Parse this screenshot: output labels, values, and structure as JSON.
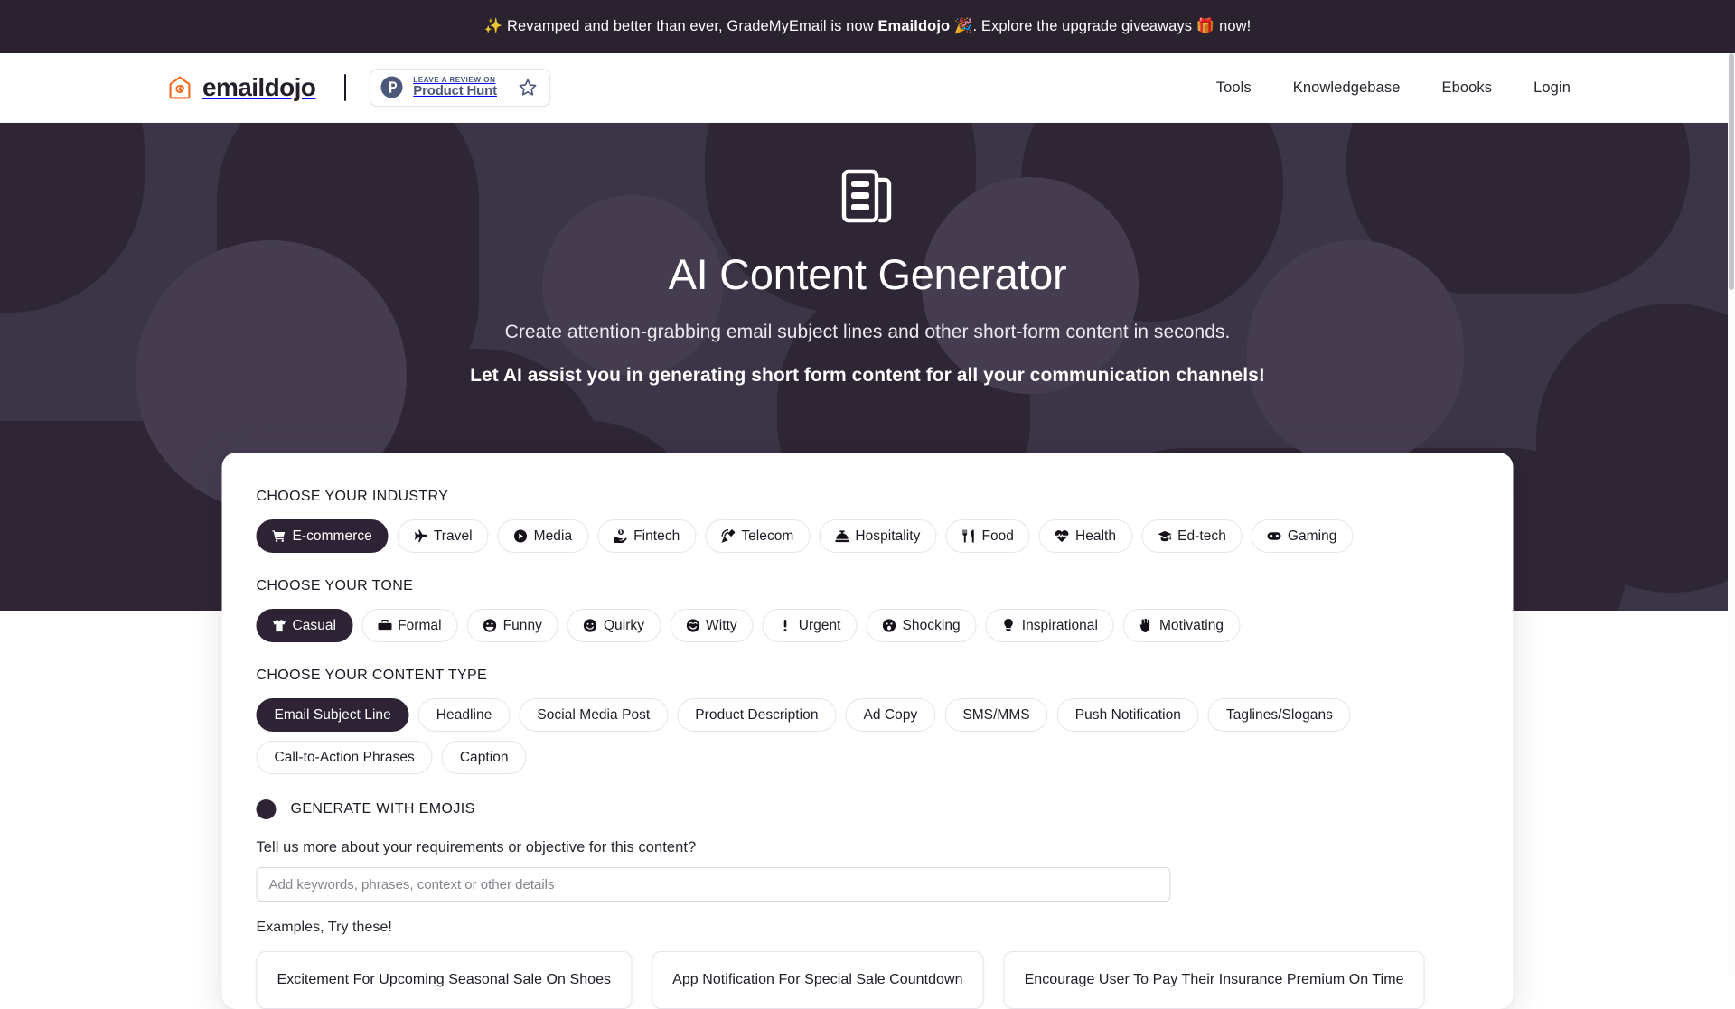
{
  "announcement": {
    "emoji_left": "✨",
    "text_before": "Revamped and better than ever, GradeMyEmail is now",
    "brand": "Emaildojo",
    "emoji_mid": "🎉",
    "text_mid": ". Explore the",
    "link": "upgrade giveaways",
    "emoji_right": "🎁",
    "text_after": "now!"
  },
  "header": {
    "logo_text": "emaildojo",
    "logo_icon": "emaildojo-spiral-house-icon",
    "product_hunt": {
      "small": "LEAVE A REVIEW ON",
      "big": "Product Hunt",
      "logo_icon": "product-hunt-p-icon",
      "star_icon": "star-outline-icon"
    },
    "nav": [
      {
        "label": "Tools"
      },
      {
        "label": "Knowledgebase"
      },
      {
        "label": "Ebooks"
      },
      {
        "label": "Login"
      }
    ]
  },
  "hero": {
    "icon": "newspaper-icon",
    "title": "AI Content Generator",
    "subtitle": "Create attention-grabbing email subject lines and other short-form content in seconds.",
    "tagline": "Let AI assist you in generating short form content for all your communication channels!"
  },
  "panel": {
    "industry": {
      "label": "CHOOSE YOUR INDUSTRY",
      "selected": "E-commerce",
      "options": [
        {
          "label": "E-commerce",
          "icon": "shopping-cart-icon"
        },
        {
          "label": "Travel",
          "icon": "plane-icon"
        },
        {
          "label": "Media",
          "icon": "play-circle-icon"
        },
        {
          "label": "Fintech",
          "icon": "hand-holding-dollar-icon"
        },
        {
          "label": "Telecom",
          "icon": "satellite-dish-icon"
        },
        {
          "label": "Hospitality",
          "icon": "concierge-bell-icon"
        },
        {
          "label": "Food",
          "icon": "utensils-icon"
        },
        {
          "label": "Health",
          "icon": "heartbeat-icon"
        },
        {
          "label": "Ed-tech",
          "icon": "graduation-cap-icon"
        },
        {
          "label": "Gaming",
          "icon": "gamepad-icon"
        }
      ]
    },
    "tone": {
      "label": "CHOOSE YOUR TONE",
      "selected": "Casual",
      "options": [
        {
          "label": "Casual",
          "icon": "tshirt-icon"
        },
        {
          "label": "Formal",
          "icon": "briefcase-icon"
        },
        {
          "label": "Funny",
          "icon": "grin-face-icon"
        },
        {
          "label": "Quirky",
          "icon": "smile-face-icon"
        },
        {
          "label": "Witty",
          "icon": "laugh-face-icon"
        },
        {
          "label": "Urgent",
          "icon": "exclamation-icon"
        },
        {
          "label": "Shocking",
          "icon": "surprise-face-icon"
        },
        {
          "label": "Inspirational",
          "icon": "lightbulb-icon"
        },
        {
          "label": "Motivating",
          "icon": "fist-raised-icon"
        }
      ]
    },
    "content_type": {
      "label": "CHOOSE YOUR CONTENT TYPE",
      "selected": "Email Subject Line",
      "options": [
        {
          "label": "Email Subject Line"
        },
        {
          "label": "Headline"
        },
        {
          "label": "Social Media Post"
        },
        {
          "label": "Product Description"
        },
        {
          "label": "Ad Copy"
        },
        {
          "label": "SMS/MMS"
        },
        {
          "label": "Push Notification"
        },
        {
          "label": "Taglines/Slogans"
        },
        {
          "label": "Call-to-Action Phrases"
        },
        {
          "label": "Caption"
        }
      ]
    },
    "emoji_toggle": {
      "label": "GENERATE WITH EMOJIS",
      "state": "on"
    },
    "requirements": {
      "question": "Tell us more about your requirements or objective for this content?",
      "placeholder": "Add keywords, phrases, context or other details",
      "value": ""
    },
    "examples": {
      "label": "Examples, Try these!",
      "items": [
        {
          "label": "Excitement For Upcoming Seasonal Sale On Shoes"
        },
        {
          "label": "App Notification For Special Sale Countdown"
        },
        {
          "label": "Encourage User To Pay Their Insurance Premium On Time"
        }
      ]
    }
  },
  "colors": {
    "accent_orange": "#f26b21",
    "hero_dark": "#3c3447",
    "chip_selected": "#2e2335",
    "announce_bg": "#2b2230",
    "product_hunt_blue": "#4b587c"
  }
}
